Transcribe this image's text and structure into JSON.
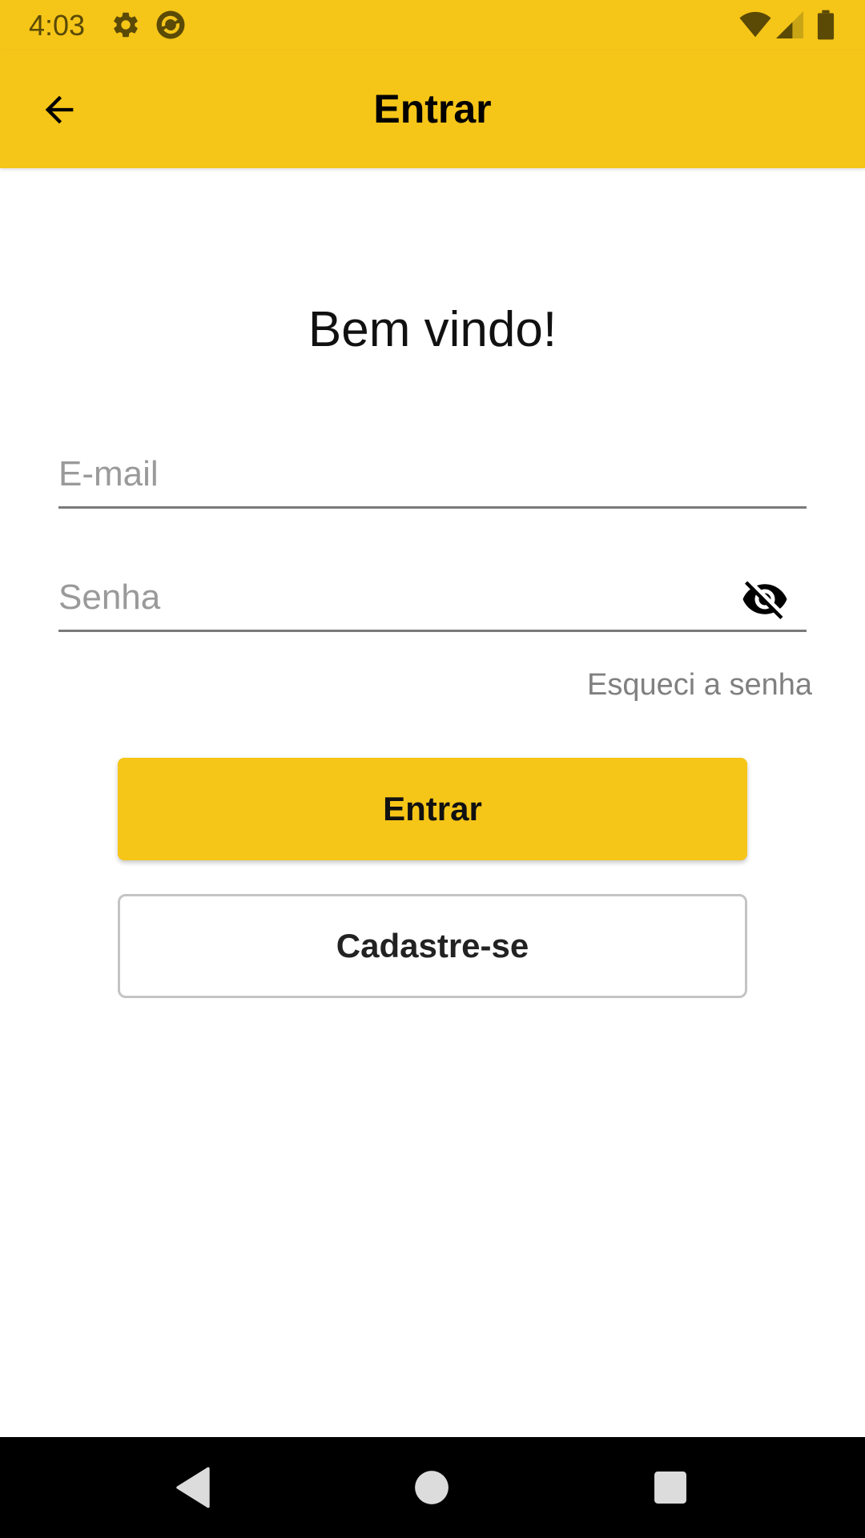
{
  "status_bar": {
    "time": "4:03",
    "icons": [
      "settings-icon",
      "sync-app-icon",
      "wifi-icon",
      "signal-icon",
      "battery-icon"
    ]
  },
  "app_bar": {
    "title": "Entrar",
    "back_icon": "arrow-back-icon"
  },
  "main": {
    "welcome": "Bem vindo!",
    "email_placeholder": "E-mail",
    "email_value": "",
    "password_placeholder": "Senha",
    "password_value": "",
    "password_toggle_icon": "eye-off-icon",
    "forgot_password": "Esqueci a senha",
    "login_button": "Entrar",
    "signup_button": "Cadastre-se"
  },
  "nav_bar": {
    "icons": [
      "nav-back-icon",
      "nav-home-icon",
      "nav-recents-icon"
    ]
  },
  "colors": {
    "accent": "#F5C518",
    "nav_background": "#000000",
    "hint_text": "#9A9A9A",
    "link_text": "#808080"
  }
}
